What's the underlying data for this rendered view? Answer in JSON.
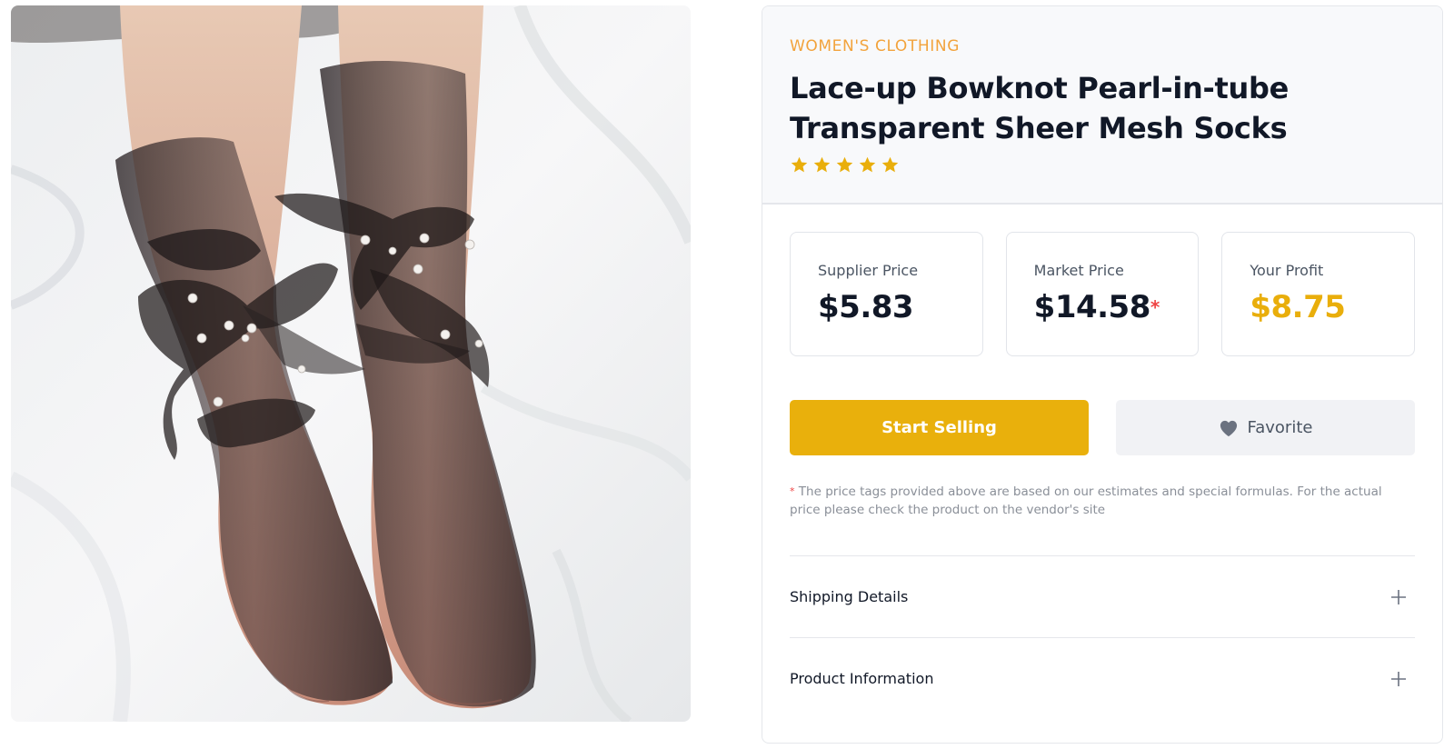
{
  "product": {
    "category": "WOMEN'S CLOTHING",
    "title_line1": "Lace-up Bowknot Pearl-in-tube",
    "title_line2": "Transparent Sheer Mesh Socks",
    "rating": 5,
    "rating_max": 5,
    "image_alt": "Feet wearing black sheer mesh socks with pearl-studded ribbon bows on white bedsheet"
  },
  "prices": [
    {
      "label": "Supplier Price",
      "value": "$5.83",
      "asterisk": ""
    },
    {
      "label": "Market Price",
      "value": "$14.58",
      "asterisk": "*"
    },
    {
      "label": "Your Profit",
      "value": "$8.75",
      "asterisk": ""
    }
  ],
  "actions": {
    "start_selling": "Start Selling",
    "favorite": "Favorite"
  },
  "disclaimer": {
    "mark": "*",
    "text": "The price tags provided above are based on our estimates and special formulas. For the actual price please check the product on the vendor's site"
  },
  "accordion": [
    {
      "label": "Shipping Details",
      "icon": "plus-icon"
    },
    {
      "label": "Product Information",
      "icon": "plus-icon"
    }
  ],
  "colors": {
    "accent": "#e9b00c",
    "category": "#f2a33c",
    "star": "#e9ae0b",
    "asterisk": "#ef4444"
  }
}
